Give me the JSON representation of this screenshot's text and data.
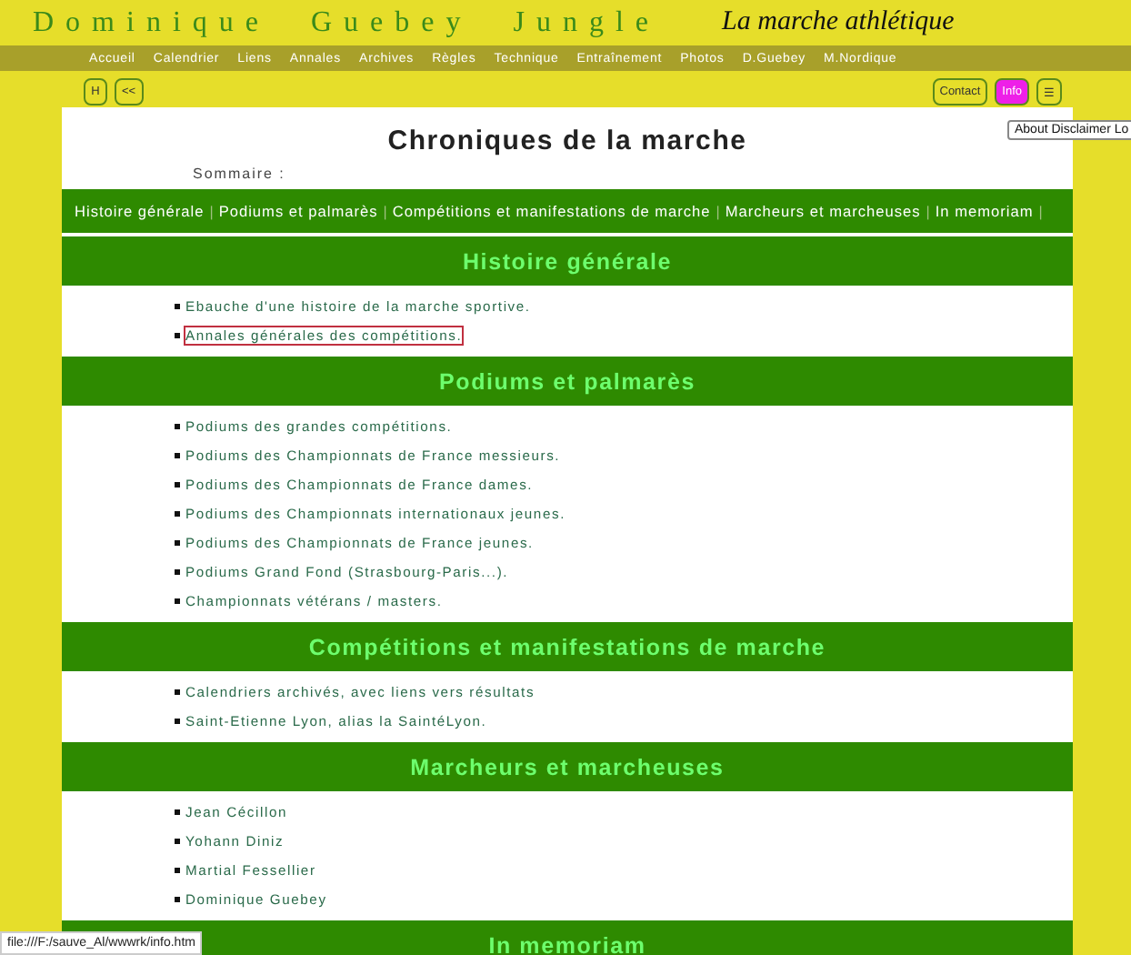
{
  "header": {
    "site_title": "Dominique Guebey Jungle",
    "subtitle": "La marche athlétique"
  },
  "nav": [
    "Accueil",
    "Calendrier",
    "Liens",
    "Annales",
    "Archives",
    "Règles",
    "Technique",
    "Entraînement",
    "Photos",
    "D.Guebey",
    "M.Nordique"
  ],
  "left_buttons": [
    "H",
    "<<"
  ],
  "right_buttons": [
    {
      "label": "Contact",
      "selected": false
    },
    {
      "label": "Info",
      "selected": true
    },
    {
      "label": "☰",
      "selected": false
    }
  ],
  "tooltip": "About Disclaimer Lo",
  "page_title": "Chroniques de la marche",
  "summary_label": "Sommaire :",
  "toc": [
    {
      "label": "Histoire générale",
      "separator": "|"
    },
    {
      "label": "Podiums et palmarès",
      "separator": "|"
    },
    {
      "label": "Compétitions et manifestations de marche",
      "separator": "|"
    },
    {
      "label": "Marcheurs et marcheuses",
      "separator": "|"
    },
    {
      "label": "In memoriam",
      "separator": "|"
    }
  ],
  "sections": [
    {
      "title": "Histoire générale",
      "items": [
        {
          "text": "Ebauche d'une histoire de la marche sportive.",
          "focused": false
        },
        {
          "text": "Annales générales des compétitions.",
          "focused": true
        }
      ]
    },
    {
      "title": "Podiums et palmarès",
      "items": [
        {
          "text": "Podiums des grandes compétitions.",
          "focused": false
        },
        {
          "text": "Podiums des Championnats de France messieurs.",
          "focused": false
        },
        {
          "text": "Podiums des Championnats de France dames.",
          "focused": false
        },
        {
          "text": "Podiums des Championnats internationaux jeunes.",
          "focused": false
        },
        {
          "text": "Podiums des Championnats de France jeunes.",
          "focused": false
        },
        {
          "text": "Podiums Grand Fond (Strasbourg-Paris...).",
          "focused": false
        },
        {
          "text": "Championnats vétérans / masters.",
          "focused": false
        }
      ]
    },
    {
      "title": "Compétitions et manifestations de marche",
      "items": [
        {
          "text": "Calendriers archivés, avec liens vers résultats",
          "focused": false
        },
        {
          "text": "Saint-Etienne Lyon, alias la SaintéLyon.",
          "focused": false
        }
      ]
    },
    {
      "title": "Marcheurs et marcheuses",
      "items": [
        {
          "text": "Jean Cécillon",
          "focused": false
        },
        {
          "text": "Yohann Diniz",
          "focused": false
        },
        {
          "text": "Martial Fessellier",
          "focused": false
        },
        {
          "text": "Dominique Guebey",
          "focused": false
        }
      ]
    },
    {
      "title": "In memoriam"
    }
  ],
  "status_bar": "file:///F:/sauve_Al/wwwrk/info.htm"
}
